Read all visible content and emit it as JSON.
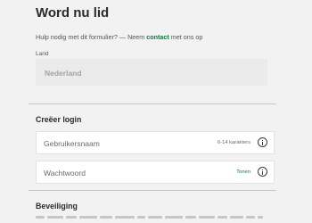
{
  "header": {
    "title": "Word nu lid"
  },
  "help": {
    "prefix": "Hulp nodig met dit formulier? — Neem ",
    "link": "contact",
    "suffix": " met ons op"
  },
  "country": {
    "label": "Land",
    "value": "Nederland"
  },
  "login": {
    "title": "Creëer login",
    "username": {
      "placeholder": "Gebruikersnaam",
      "hint": "6-14 karakters",
      "icon": "info-icon"
    },
    "password": {
      "placeholder": "Wachtwoord",
      "toggle": "Tonen",
      "icon": "info-icon"
    }
  },
  "security": {
    "title": "Beveiliging"
  },
  "colors": {
    "accent": "#107c41",
    "background": "#f2f2f2"
  }
}
